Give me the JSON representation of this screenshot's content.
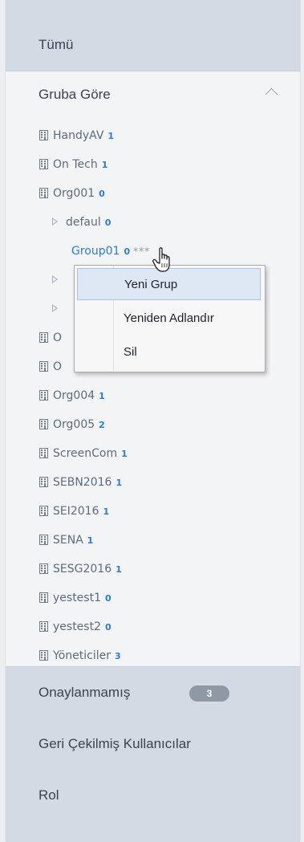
{
  "sidebar": {
    "all_label": "Tümü",
    "group_by_label": "Gruba Göre",
    "tree": [
      {
        "name": "HandyAV",
        "count": "1"
      },
      {
        "name": "On Tech",
        "count": "1"
      },
      {
        "name": "Org001",
        "count": "0"
      },
      {
        "name": "defaul",
        "count": "0"
      },
      {
        "name": "Group01",
        "count": "0",
        "trailing": "***"
      },
      {
        "name": "O"
      },
      {
        "name": "O"
      },
      {
        "name": "Org004",
        "count": "1"
      },
      {
        "name": "Org005",
        "count": "2"
      },
      {
        "name": "ScreenCom",
        "count": "1"
      },
      {
        "name": "SEBN2016",
        "count": "1"
      },
      {
        "name": "SEI2016",
        "count": "1"
      },
      {
        "name": "SENA",
        "count": "1"
      },
      {
        "name": "SESG2016",
        "count": "1"
      },
      {
        "name": "yestest1",
        "count": "0"
      },
      {
        "name": "yestest2",
        "count": "0"
      },
      {
        "name": "Yöneticiler",
        "count": "3"
      }
    ],
    "unapproved_label": "Onaylanmamış",
    "unapproved_count": "3",
    "revoked_label": "Geri Çekilmiş Kullanıcılar",
    "role_label": "Rol"
  },
  "context_menu": {
    "items": [
      "Yeni Grup",
      "Yeniden Adlandır",
      "Sil"
    ]
  },
  "colors": {
    "accent": "#2e7bd0",
    "section_bg": "#d3dae3",
    "panel_bg": "#f3f4f6"
  }
}
